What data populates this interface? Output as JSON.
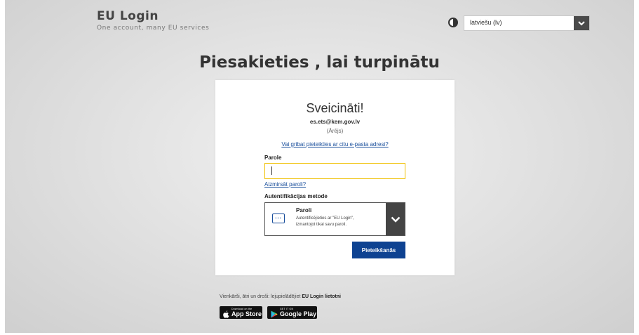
{
  "header": {
    "brand_title": "EU Login",
    "brand_tagline": "One account, many EU services",
    "contrast_icon": "contrast-icon",
    "language": {
      "selected": "latviešu (lv)",
      "chevron_icon": "chevron-down-icon"
    }
  },
  "page": {
    "title": "Piesakieties , lai turpinātu"
  },
  "login_card": {
    "greeting": "Sveicināti!",
    "user_email": "es.ets@kem.gov.lv",
    "user_type": "(Ārējs)",
    "other_email_link": "Vai gribat pieteikties ar citu e-pasta adresi?",
    "password_label": "Parole",
    "password_value": "",
    "forgot_password_link": "Aizmirsāt paroli?",
    "auth_method_label": "Autentifikācijas metode",
    "auth_method": {
      "icon": "password-dots-icon",
      "name": "Paroli",
      "description": "Autentificējieties ar \"EU Login\", izmantojot tikai savu paroli."
    },
    "signin_button": "Pieteikšanās"
  },
  "promo": {
    "text_prefix": "Vienkārši, ātri un droši: lejupielādējiet",
    "text_bold": "EU Login lietotni",
    "app_store": {
      "small": "Download on the",
      "big": "App Store"
    },
    "google_play": {
      "small": "GET IT ON",
      "big": "Google Play"
    }
  },
  "colors": {
    "primary_blue": "#0e4291",
    "link_blue": "#1a4f9c",
    "focus_yellow": "#f0c000",
    "dark_gray": "#444444"
  }
}
